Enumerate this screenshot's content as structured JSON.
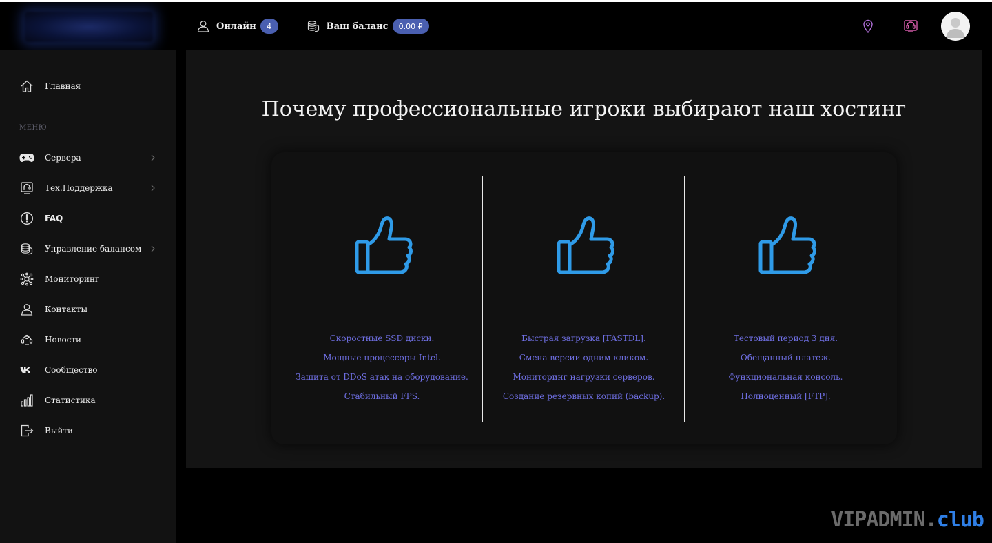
{
  "header": {
    "online_label": "Онлайн",
    "online_count": "4",
    "balance_label": "Ваш баланс",
    "balance_value": "0.00 ₽"
  },
  "sidebar": {
    "home": "Главная",
    "menu_title": "МЕНЮ",
    "items": [
      {
        "label": "Сервера",
        "icon": "gamepad-icon",
        "has_submenu": true
      },
      {
        "label": "Тех.Поддержка",
        "icon": "support-monitor-icon",
        "has_submenu": true
      },
      {
        "label": "FAQ",
        "icon": "exclamation-circle-icon",
        "has_submenu": false
      },
      {
        "label": "Управление балансом",
        "icon": "coins-icon",
        "has_submenu": true
      },
      {
        "label": "Мониторинг",
        "icon": "monitoring-icon",
        "has_submenu": false
      },
      {
        "label": "Контакты",
        "icon": "contacts-icon",
        "has_submenu": false
      },
      {
        "label": "Новости",
        "icon": "news-icon",
        "has_submenu": false
      },
      {
        "label": "Сообщество",
        "icon": "vk-icon",
        "has_submenu": false
      },
      {
        "label": "Статистика",
        "icon": "bar-chart-icon",
        "has_submenu": false
      },
      {
        "label": "Выйти",
        "icon": "logout-icon",
        "has_submenu": false
      }
    ]
  },
  "main": {
    "title": "Почему профессиональные игроки выбирают наш хостинг",
    "columns": [
      {
        "icon": "thumbs-up-icon",
        "lines": [
          "Скоростные SSD диски.",
          "Мощные процессоры Intel.",
          "Защита от DDoS атак на оборудование.",
          "Стабильный FPS."
        ]
      },
      {
        "icon": "thumbs-up-icon",
        "lines": [
          "Быстрая загрузка [FASTDL].",
          "Смена версии одним кликом.",
          "Мониторинг нагрузки серверов.",
          "Создание резервных копий (backup)."
        ]
      },
      {
        "icon": "thumbs-up-icon",
        "lines": [
          "Тестовый период 3 дня.",
          "Обещанный платеж.",
          "Функциональная консоль.",
          "Полноценный [FTP]."
        ]
      }
    ]
  },
  "watermark": {
    "part1": "VIPADMIN.",
    "part2": "club"
  },
  "colors": {
    "accent": "#4a5fb0",
    "feature_text": "#6f6fe3",
    "thumb": "#2f9be8",
    "panel": "#141414",
    "sidebar": "#121212"
  }
}
